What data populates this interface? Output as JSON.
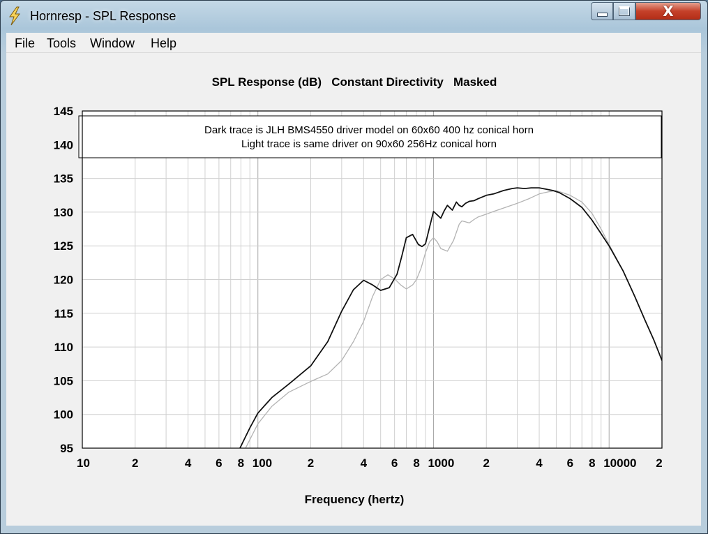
{
  "window": {
    "title": "Hornresp - SPL Response",
    "controls": {
      "minimize": "minimize",
      "maximize": "maximize",
      "close": "close"
    }
  },
  "menu": {
    "items": [
      "File",
      "Tools",
      "Window",
      "Help"
    ]
  },
  "colors": {
    "dark_trace": "#111111",
    "light_trace": "#b3b3b3",
    "grid": "#d0d0d0",
    "plot_bg": "#ffffff",
    "client_bg": "#f0f0f0"
  },
  "icons": {
    "app": "lightning-bolt-icon"
  },
  "chart_data": {
    "type": "line",
    "title": "SPL Response (dB)   Constant Directivity   Masked",
    "xlabel": "Frequency (hertz)",
    "ylabel": "",
    "xscale": "log",
    "xlim": [
      10,
      20000
    ],
    "ylim": [
      95,
      145
    ],
    "grid": true,
    "yticks": [
      "145",
      "140",
      "135",
      "130",
      "125",
      "120",
      "115",
      "110",
      "105",
      "100",
      "95"
    ],
    "xticks": [
      {
        "value": 10,
        "label": "10"
      },
      {
        "value": 20,
        "label": "2"
      },
      {
        "value": 40,
        "label": "4"
      },
      {
        "value": 60,
        "label": "6"
      },
      {
        "value": 80,
        "label": "8"
      },
      {
        "value": 100,
        "label": "100"
      },
      {
        "value": 200,
        "label": "2"
      },
      {
        "value": 400,
        "label": "4"
      },
      {
        "value": 600,
        "label": "6"
      },
      {
        "value": 800,
        "label": "8"
      },
      {
        "value": 1000,
        "label": "1000"
      },
      {
        "value": 2000,
        "label": "2"
      },
      {
        "value": 4000,
        "label": "4"
      },
      {
        "value": 6000,
        "label": "6"
      },
      {
        "value": 8000,
        "label": "8"
      },
      {
        "value": 10000,
        "label": "10000"
      },
      {
        "value": 20000,
        "label": "2"
      }
    ],
    "annotation": [
      "Dark trace is JLH BMS4550 driver model on 60x60 400 hz conical horn",
      "Light trace is same driver on 90x60 256Hz conical horn"
    ],
    "series": [
      {
        "style": "dark",
        "x": [
          79,
          90,
          100,
          120,
          150,
          200,
          250,
          300,
          350,
          400,
          450,
          500,
          560,
          620,
          660,
          700,
          760,
          820,
          860,
          900,
          950,
          1000,
          1050,
          1100,
          1150,
          1200,
          1280,
          1350,
          1400,
          1450,
          1520,
          1600,
          1700,
          1800,
          2000,
          2200,
          2500,
          2800,
          3000,
          3300,
          3600,
          4000,
          4400,
          4800,
          5200,
          6000,
          7000,
          8000,
          9000,
          10000,
          12000,
          14000,
          16000,
          18000,
          20000
        ],
        "y": [
          95,
          98,
          100.2,
          102.5,
          104.5,
          107.2,
          110.8,
          115.3,
          118.5,
          119.9,
          119.2,
          118.4,
          118.8,
          120.8,
          123.5,
          126.2,
          126.7,
          125.2,
          124.9,
          125.3,
          127.8,
          130.1,
          129.6,
          129.1,
          130.2,
          131.0,
          130.3,
          131.5,
          131.0,
          130.8,
          131.3,
          131.6,
          131.7,
          132.0,
          132.5,
          132.7,
          133.2,
          133.5,
          133.6,
          133.5,
          133.6,
          133.6,
          133.4,
          133.2,
          132.9,
          132.0,
          130.7,
          128.8,
          126.8,
          125.0,
          121.3,
          117.5,
          114.0,
          111.0,
          108.0
        ]
      },
      {
        "style": "light",
        "x": [
          85,
          100,
          120,
          150,
          200,
          250,
          300,
          350,
          400,
          450,
          500,
          550,
          600,
          650,
          700,
          760,
          800,
          850,
          900,
          950,
          1000,
          1050,
          1100,
          1200,
          1300,
          1400,
          1450,
          1500,
          1600,
          1700,
          1800,
          2000,
          2200,
          2500,
          3000,
          3500,
          4000,
          4500,
          5000,
          6000,
          7000,
          8000,
          9000,
          10000,
          12000,
          14000,
          16000,
          18000,
          20000
        ],
        "y": [
          95,
          98.6,
          101.2,
          103.3,
          104.9,
          106.0,
          108.0,
          110.8,
          113.8,
          117.5,
          120.0,
          120.7,
          120.1,
          119.2,
          118.6,
          119.2,
          120.0,
          121.7,
          124.0,
          125.6,
          126.2,
          125.6,
          124.6,
          124.2,
          125.8,
          128.2,
          128.7,
          128.6,
          128.4,
          128.9,
          129.3,
          129.7,
          130.1,
          130.6,
          131.3,
          132.0,
          132.7,
          133.0,
          133.2,
          132.5,
          131.5,
          129.8,
          127.5,
          125.2,
          121.3,
          117.5,
          114.0,
          111.0,
          108.0
        ]
      }
    ]
  }
}
